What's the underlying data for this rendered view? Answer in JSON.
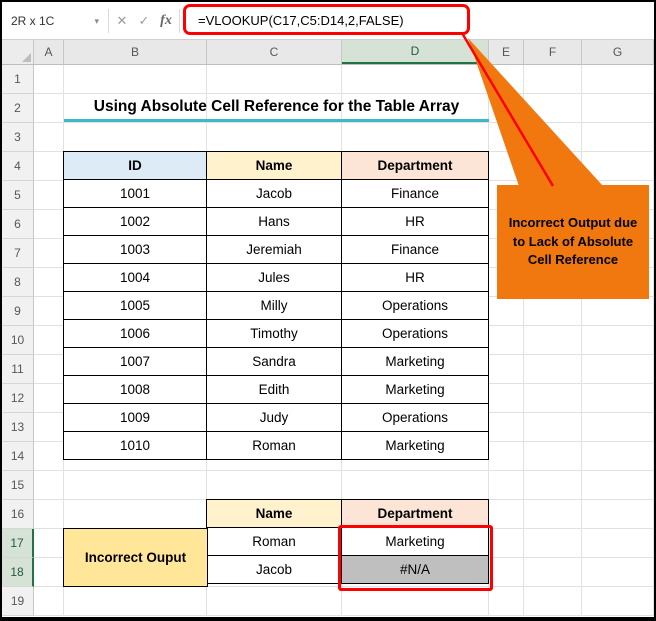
{
  "formula_bar": {
    "name_box": "2R x 1C",
    "dropdown_icon": "▾",
    "cancel_icon": "✕",
    "enter_icon": "✓",
    "fx_label": "fx",
    "formula": "=VLOOKUP(C17,C5:D14,2,FALSE)"
  },
  "grid": {
    "columns": [
      "A",
      "B",
      "C",
      "D",
      "E",
      "F",
      "G"
    ],
    "rows": [
      "1",
      "2",
      "3",
      "4",
      "5",
      "6",
      "7",
      "8",
      "9",
      "10",
      "11",
      "12",
      "13",
      "14",
      "15",
      "16",
      "17",
      "18",
      "19"
    ],
    "selected_column": "D",
    "selected_rows": [
      "17",
      "18"
    ]
  },
  "sheet": {
    "title": "Using Absolute Cell Reference for the Table Array",
    "main_table": {
      "headers": [
        "ID",
        "Name",
        "Department"
      ],
      "rows": [
        [
          "1001",
          "Jacob",
          "Finance"
        ],
        [
          "1002",
          "Hans",
          "HR"
        ],
        [
          "1003",
          "Jeremiah",
          "Finance"
        ],
        [
          "1004",
          "Jules",
          "HR"
        ],
        [
          "1005",
          "Milly",
          "Operations"
        ],
        [
          "1006",
          "Timothy",
          "Operations"
        ],
        [
          "1007",
          "Sandra",
          "Marketing"
        ],
        [
          "1008",
          "Edith",
          "Marketing"
        ],
        [
          "1009",
          "Judy",
          "Operations"
        ],
        [
          "1010",
          "Roman",
          "Marketing"
        ]
      ]
    },
    "result_table": {
      "headers": [
        "Name",
        "Department"
      ],
      "row_label": "Incorrect Ouput",
      "rows": [
        [
          "Roman",
          "Marketing"
        ],
        [
          "Jacob",
          "#N/A"
        ]
      ]
    },
    "callout": {
      "text": "Incorrect Output due to Lack of Absolute Cell Reference"
    }
  },
  "colors": {
    "header_id_fill": "#DDEBF7",
    "header_name_fill": "#FFF2CC",
    "header_dept_fill": "#FCE4D6",
    "label_fill": "#FFE699",
    "na_fill": "#BFBFBF",
    "callout_fill": "#F0780E",
    "annotation_red": "#FF0000",
    "title_underline": "#3BB8C9",
    "selection_green": "#217346"
  }
}
